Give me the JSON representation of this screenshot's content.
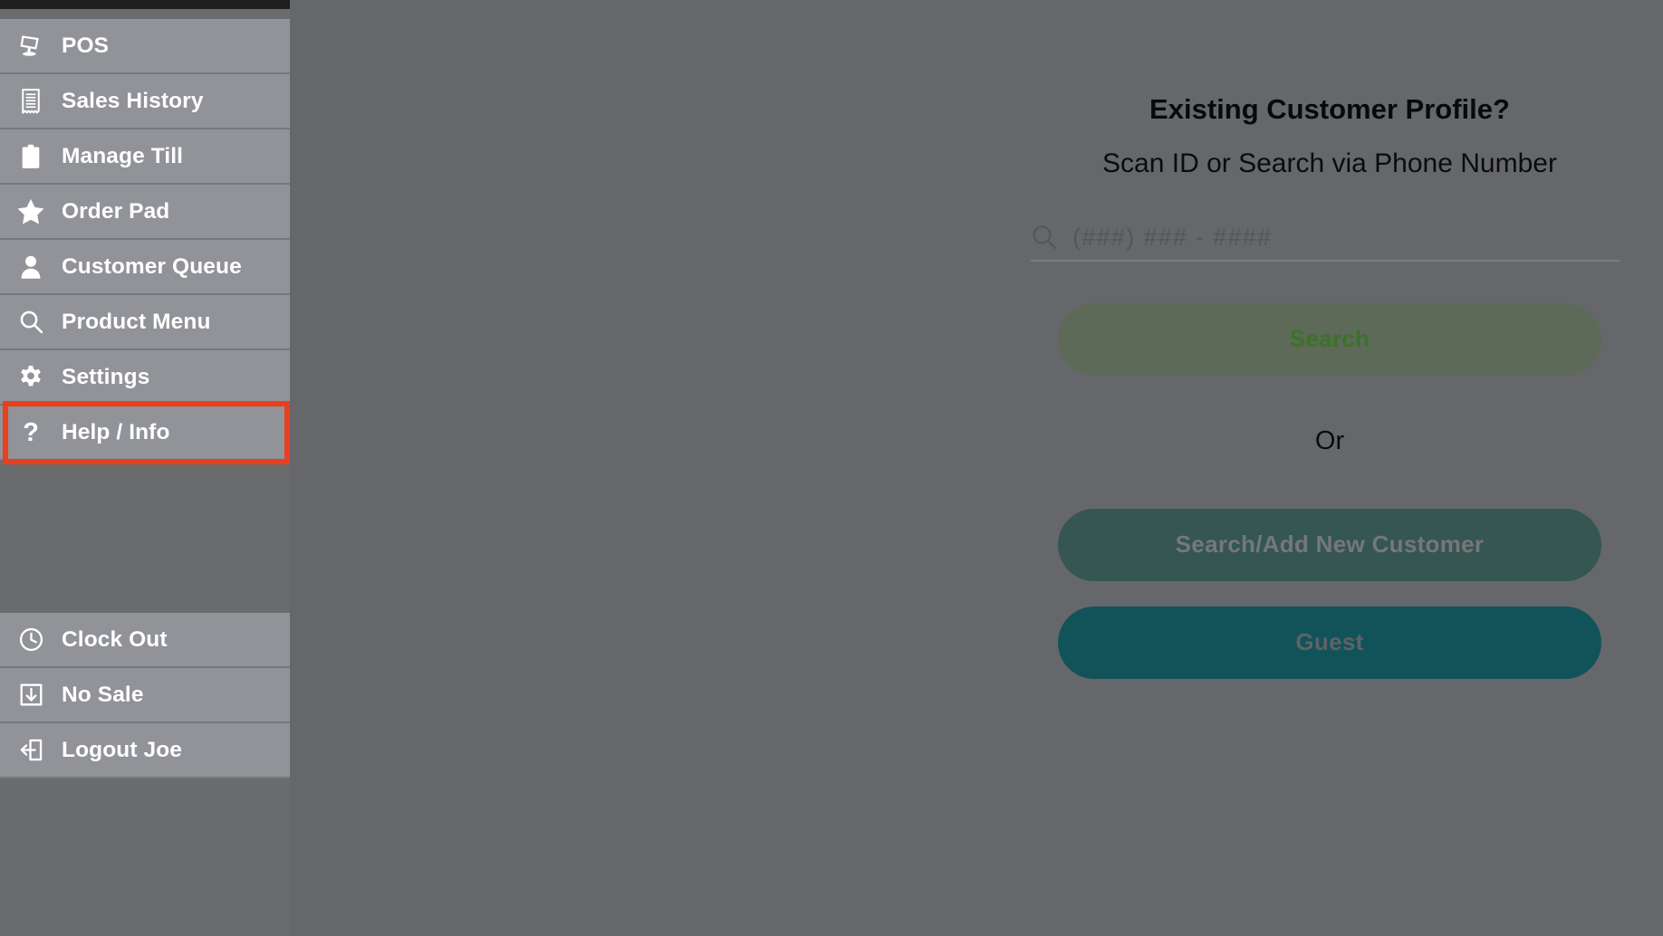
{
  "sidebar": {
    "primary_items": [
      {
        "label": "POS",
        "icon": "pos-terminal-icon"
      },
      {
        "label": "Sales History",
        "icon": "receipt-icon"
      },
      {
        "label": "Manage Till",
        "icon": "clipboard-icon"
      },
      {
        "label": "Order Pad",
        "icon": "star-icon"
      },
      {
        "label": "Customer Queue",
        "icon": "person-icon"
      },
      {
        "label": "Product Menu",
        "icon": "search-icon"
      },
      {
        "label": "Settings",
        "icon": "gear-icon"
      },
      {
        "label": "Help / Info",
        "icon": "question-mark-icon"
      }
    ],
    "bottom_items": [
      {
        "label": "Clock Out",
        "icon": "clock-icon"
      },
      {
        "label": "No Sale",
        "icon": "no-sale-drawer-icon"
      },
      {
        "label": "Logout Joe",
        "icon": "logout-arrow-icon"
      }
    ],
    "highlighted_item": "Settings",
    "highlight_color": "#e8401f"
  },
  "modal": {
    "title": "Existing Customer Profile?",
    "subtitle": "Scan ID or Search via Phone Number",
    "search": {
      "icon": "search-icon",
      "placeholder": "(###) ### - ####",
      "value": ""
    },
    "search_button_label": "Search",
    "or_label": "Or",
    "new_customer_button_label": "Search/Add New Customer",
    "guest_button_label": "Guest"
  },
  "colors": {
    "sidebar_item": "#919398",
    "overlay": "#66676a",
    "search_button": "#5d6a58",
    "search_button_text": "#3b7327",
    "new_customer_button": "#355651",
    "guest_button": "#12535a",
    "highlight": "#e8401f"
  }
}
